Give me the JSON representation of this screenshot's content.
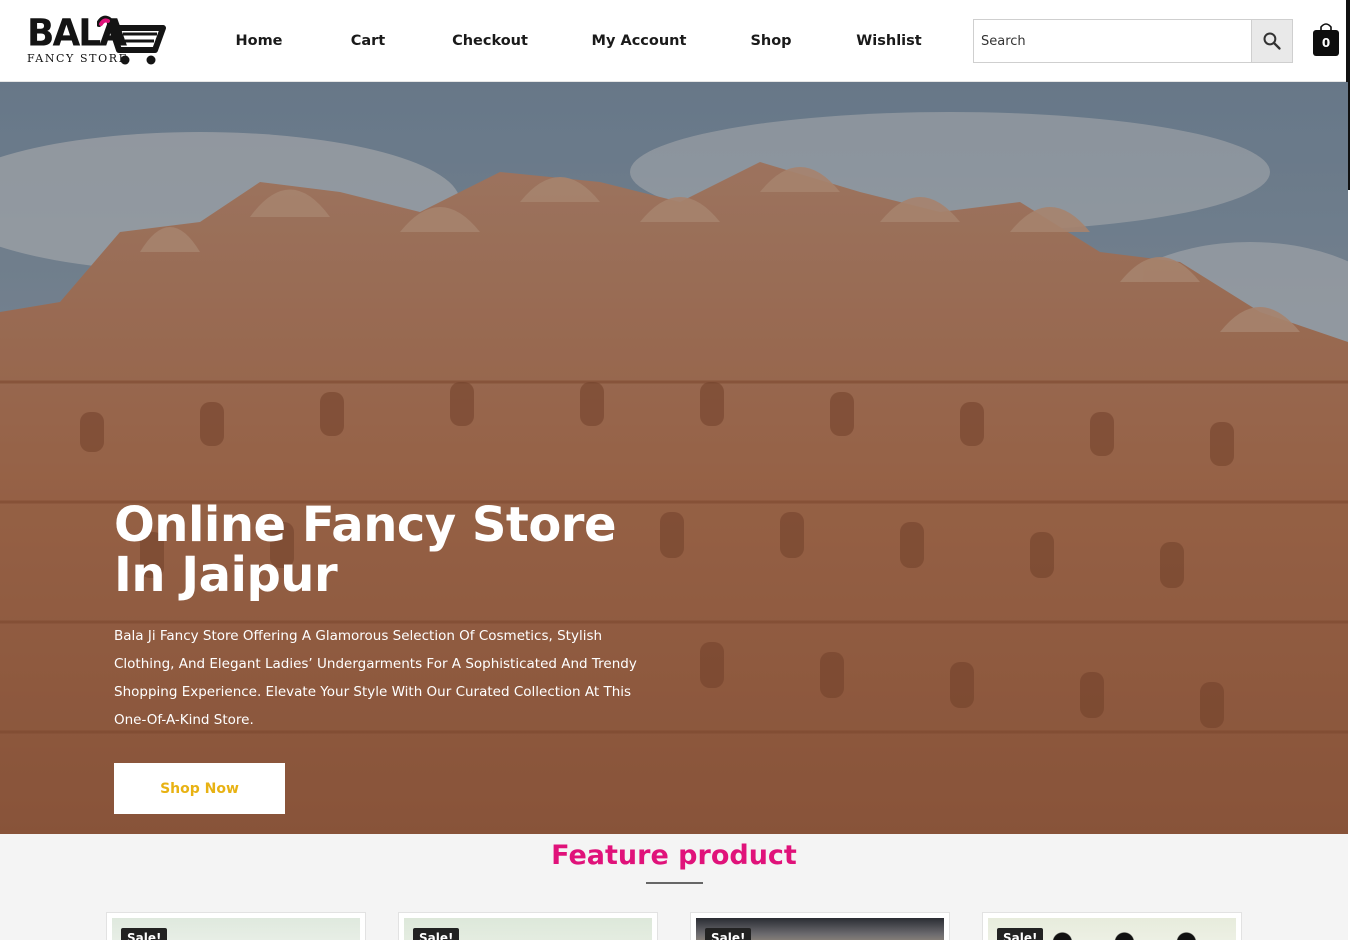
{
  "brand": {
    "name": "BALA",
    "tagline": "FANCY STORE"
  },
  "nav": {
    "items": [
      {
        "label": "Home"
      },
      {
        "label": "Cart"
      },
      {
        "label": "Checkout"
      },
      {
        "label": "My Account"
      },
      {
        "label": "Shop"
      },
      {
        "label": "Wishlist"
      }
    ]
  },
  "search": {
    "placeholder": "Search",
    "value": ""
  },
  "cart": {
    "count": "0"
  },
  "hero": {
    "title_line1": "Online Fancy Store",
    "title_line2": "In Jaipur",
    "description": "Bala Ji Fancy Store Offering A Glamorous Selection Of Cosmetics, Stylish Clothing, And Elegant Ladies’ Undergarments For A Sophisticated And Trendy Shopping Experience. Elevate Your Style With Our Curated Collection At This One-Of-A-Kind Store.",
    "button_label": "Shop Now"
  },
  "feature": {
    "title": "Feature product",
    "products": [
      {
        "badge": "Sale!"
      },
      {
        "badge": "Sale!"
      },
      {
        "badge": "Sale!"
      },
      {
        "badge": "Sale!"
      }
    ]
  },
  "colors": {
    "accent_pink": "#e0127a",
    "button_text_yellow": "#e8b213",
    "header_bg": "#ffffff",
    "text_dark": "#1a1a1a"
  }
}
